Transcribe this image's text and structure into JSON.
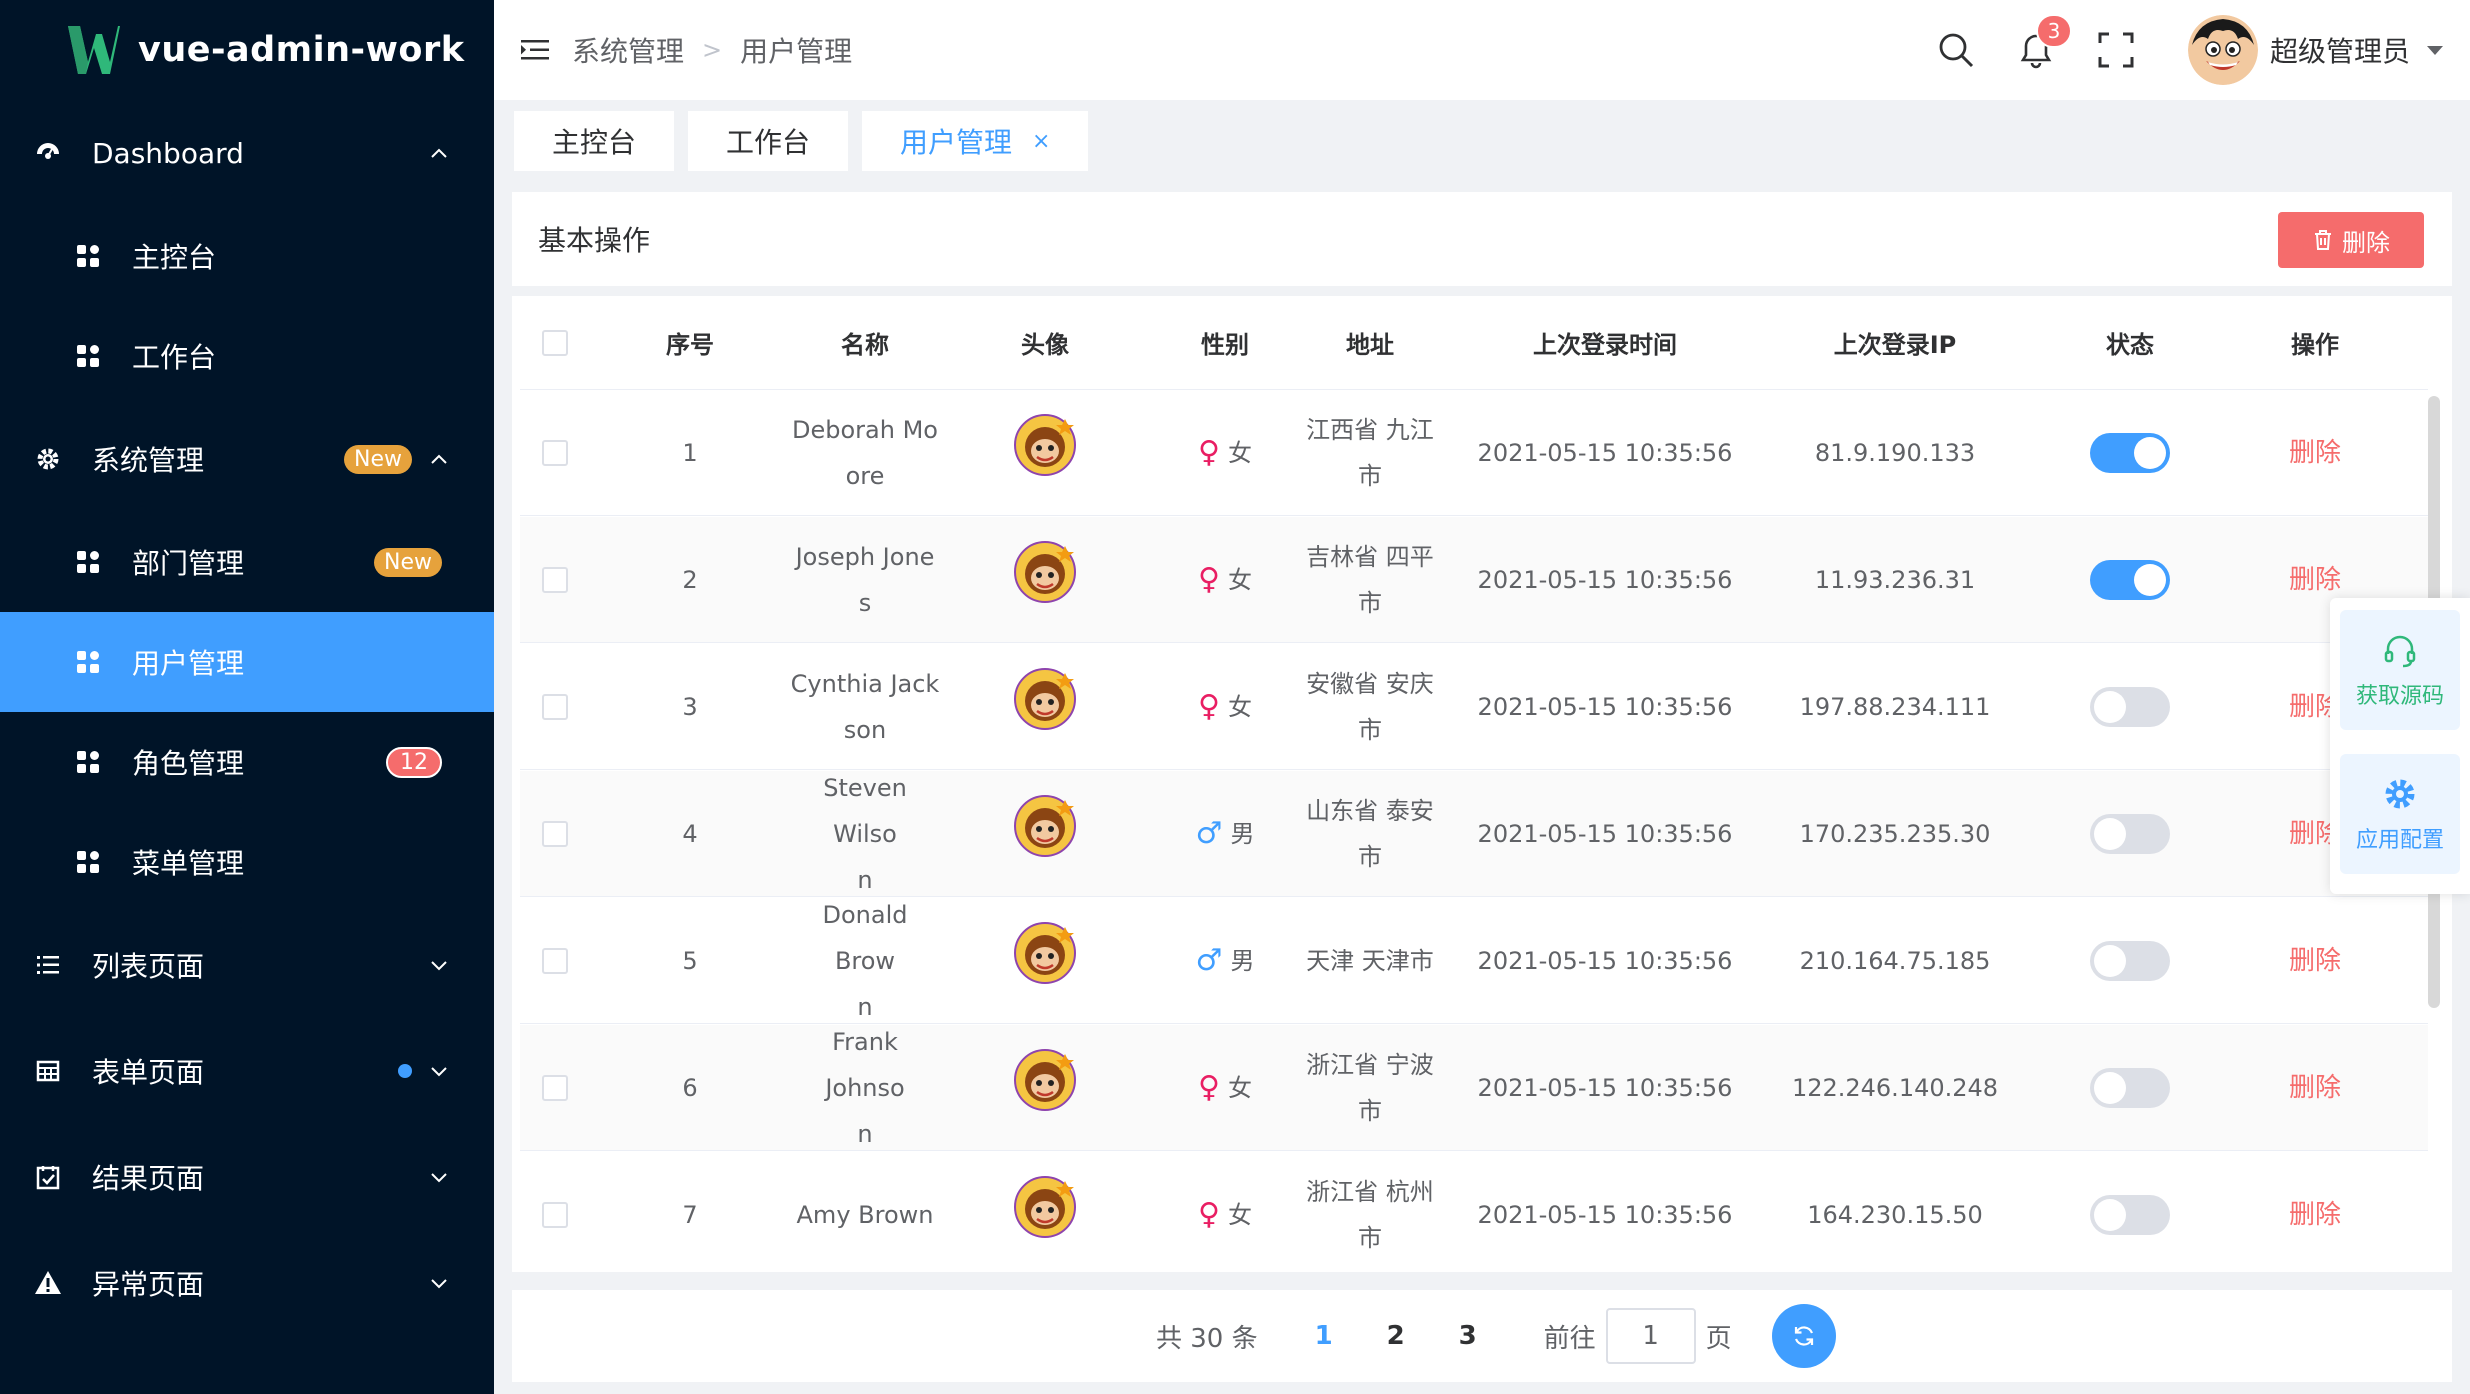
{
  "app": {
    "logo_text": "vue-admin-work"
  },
  "colors": {
    "sidebar_bg": "#001428",
    "accent": "#409eff",
    "danger": "#f56c6c",
    "warning": "#e6a23c",
    "female": "#e91e63",
    "male": "#409eff"
  },
  "sidebar": {
    "items": [
      {
        "label": "Dashboard",
        "icon": "dashboard-icon",
        "expanded": true
      },
      {
        "label": "主控台",
        "icon": "grid-icon"
      },
      {
        "label": "工作台",
        "icon": "grid-icon"
      },
      {
        "label": "系统管理",
        "icon": "gear-icon",
        "badge": "New",
        "expanded": true
      },
      {
        "label": "部门管理",
        "icon": "grid-icon",
        "badge": "New"
      },
      {
        "label": "用户管理",
        "icon": "grid-icon",
        "active": true
      },
      {
        "label": "角色管理",
        "icon": "grid-icon",
        "badge": "12"
      },
      {
        "label": "菜单管理",
        "icon": "grid-icon"
      },
      {
        "label": "列表页面",
        "icon": "list-icon"
      },
      {
        "label": "表单页面",
        "icon": "table-icon",
        "dot": true
      },
      {
        "label": "结果页面",
        "icon": "checklist-icon"
      },
      {
        "label": "异常页面",
        "icon": "warning-icon"
      }
    ]
  },
  "header": {
    "breadcrumb": [
      "系统管理",
      "用户管理"
    ],
    "notification_count": "3",
    "username": "超级管理员"
  },
  "tabs": [
    {
      "label": "主控台"
    },
    {
      "label": "工作台"
    },
    {
      "label": "用户管理",
      "active": true,
      "close": "×"
    }
  ],
  "toolbar": {
    "title": "基本操作",
    "delete_label": "删除"
  },
  "table": {
    "headers": [
      "序号",
      "名称",
      "头像",
      "性别",
      "地址",
      "上次登录时间",
      "上次登录IP",
      "状态",
      "操作"
    ],
    "rows": [
      {
        "idx": "1",
        "name_l1": "Deborah Mo",
        "name_l2": "ore",
        "gender_sym": "♀",
        "gender": "女",
        "addr_l1": "江西省 九江",
        "addr_l2": "市",
        "time": "2021-05-15 10:35:56",
        "ip": "81.9.190.133",
        "status": true,
        "op": "删除"
      },
      {
        "idx": "2",
        "name_l1": "Joseph Jone",
        "name_l2": "s",
        "gender_sym": "♀",
        "gender": "女",
        "addr_l1": "吉林省 四平",
        "addr_l2": "市",
        "time": "2021-05-15 10:35:56",
        "ip": "11.93.236.31",
        "status": true,
        "op": "删除"
      },
      {
        "idx": "3",
        "name_l1": "Cynthia Jack",
        "name_l2": "son",
        "gender_sym": "♀",
        "gender": "女",
        "addr_l1": "安徽省 安庆",
        "addr_l2": "市",
        "time": "2021-05-15 10:35:56",
        "ip": "197.88.234.111",
        "status": false,
        "op": "删除"
      },
      {
        "idx": "4",
        "name_l1": "Steven Wilso",
        "name_l2": "n",
        "gender_sym": "♂",
        "gender": "男",
        "addr_l1": "山东省 泰安",
        "addr_l2": "市",
        "time": "2021-05-15 10:35:56",
        "ip": "170.235.235.30",
        "status": false,
        "op": "删除"
      },
      {
        "idx": "5",
        "name_l1": "Donald Brow",
        "name_l2": "n",
        "gender_sym": "♂",
        "gender": "男",
        "addr_l1": "天津 天津市",
        "addr_l2": "",
        "time": "2021-05-15 10:35:56",
        "ip": "210.164.75.185",
        "status": false,
        "op": "删除"
      },
      {
        "idx": "6",
        "name_l1": "Frank Johnso",
        "name_l2": "n",
        "gender_sym": "♀",
        "gender": "女",
        "addr_l1": "浙江省 宁波",
        "addr_l2": "市",
        "time": "2021-05-15 10:35:56",
        "ip": "122.246.140.248",
        "status": false,
        "op": "删除"
      },
      {
        "idx": "7",
        "name_l1": "Amy Brown",
        "name_l2": "",
        "gender_sym": "♀",
        "gender": "女",
        "addr_l1": "浙江省 杭州",
        "addr_l2": "市",
        "time": "2021-05-15 10:35:56",
        "ip": "164.230.15.50",
        "status": false,
        "op": "删除"
      }
    ]
  },
  "pagination": {
    "total_text": "共 30 条",
    "pages": [
      "1",
      "2",
      "3"
    ],
    "current": "1",
    "goto_prefix": "前往",
    "goto_value": "1",
    "goto_suffix": "页"
  },
  "float_panel": {
    "source_label": "获取源码",
    "config_label": "应用配置"
  }
}
